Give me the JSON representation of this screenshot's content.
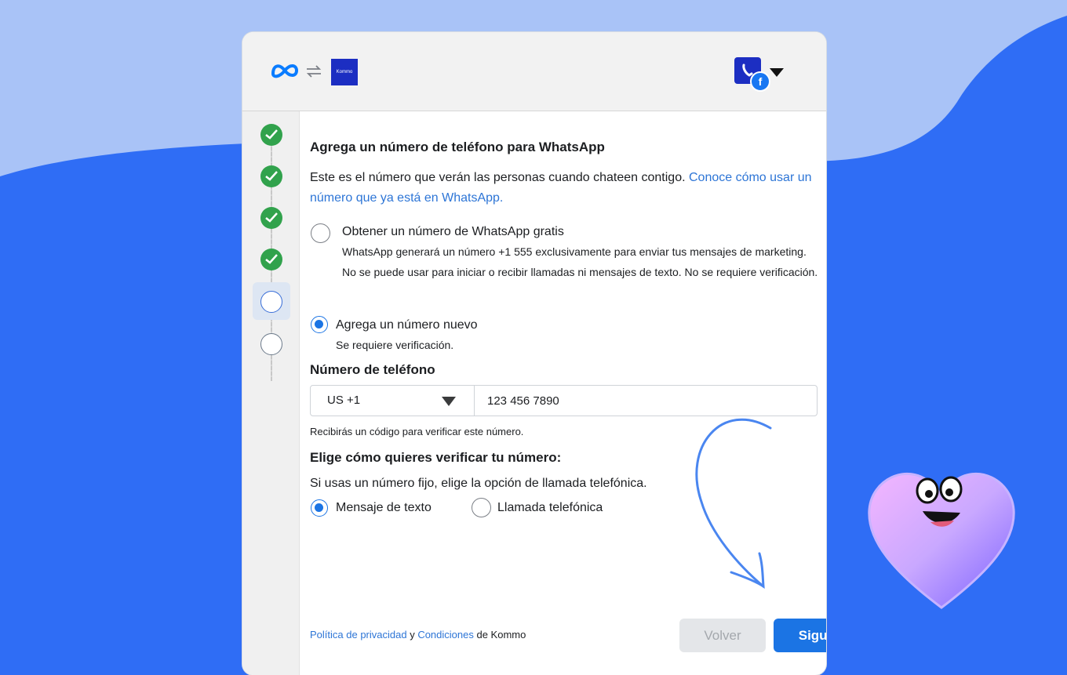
{
  "header": {
    "kommo_logo_text": "Kommo"
  },
  "stepper": {
    "steps": [
      "done",
      "done",
      "done",
      "done",
      "current",
      "pending"
    ]
  },
  "form": {
    "title": "Agrega un número de teléfono para WhatsApp",
    "intro_text": "Este es el número que verán las personas cuando chateen contigo. ",
    "intro_link": "Conoce cómo usar un número que ya está en WhatsApp.",
    "option_free_title": "Obtener un número de WhatsApp gratis",
    "option_free_desc": "WhatsApp generará un número +1 555 exclusivamente para enviar tus mensajes de marketing. No se puede usar para iniciar o recibir llamadas ni mensajes de texto. No se requiere verificación.",
    "option_new_title": "Agrega un número nuevo",
    "option_new_desc": "Se requiere verificación.",
    "phone_label": "Número de teléfono",
    "country_code": "US +1",
    "phone_value": "123 456 7890",
    "code_note": "Recibirás un código para verificar este número.",
    "verify_title": "Elige cómo quieres verificar tu número:",
    "verify_desc": "Si usas un número fijo, elige la opción de llamada telefónica.",
    "verify_sms": "Mensaje de texto",
    "verify_call": "Llamada telefónica"
  },
  "footer": {
    "privacy_link": "Política de privacidad",
    "and": " y ",
    "terms_link": "Condiciones",
    "suffix": " de Kommo",
    "back_label": "Volver",
    "next_label": "Siguiente"
  },
  "colors": {
    "accent": "#1b74e4",
    "success": "#31a24c",
    "background": "#2f6df5"
  }
}
